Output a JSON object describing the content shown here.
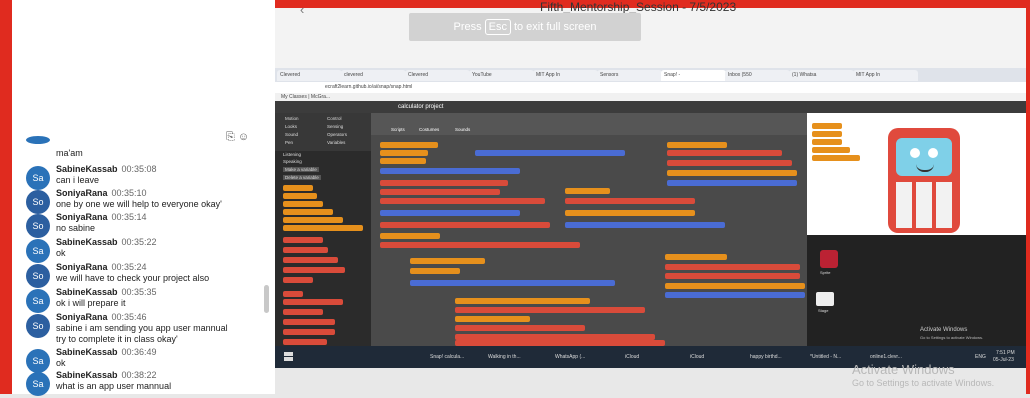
{
  "meeting": {
    "title": "Fifth_Mentorship_Session - 7/5/2023",
    "esc_prefix": "Press",
    "esc_key": "Esc",
    "esc_suffix": "to exit full screen"
  },
  "chat": {
    "messages": [
      {
        "initials": "",
        "name": "",
        "time": "",
        "text": "ma'am",
        "text2": ""
      },
      {
        "initials": "Sa",
        "name": "SabineKassab",
        "time": "00:35:08",
        "text": "can i leave",
        "text2": ""
      },
      {
        "initials": "So",
        "name": "SoniyaRana",
        "time": "00:35:10",
        "text": "one by one we will help to everyone okay'",
        "text2": ""
      },
      {
        "initials": "So",
        "name": "SoniyaRana",
        "time": "00:35:14",
        "text": "no sabine",
        "text2": ""
      },
      {
        "initials": "Sa",
        "name": "SabineKassab",
        "time": "00:35:22",
        "text": "ok",
        "text2": ""
      },
      {
        "initials": "So",
        "name": "SoniyaRana",
        "time": "00:35:24",
        "text": "we will have to check your project also",
        "text2": ""
      },
      {
        "initials": "Sa",
        "name": "SabineKassab",
        "time": "00:35:35",
        "text": "ok i will prepare it",
        "text2": ""
      },
      {
        "initials": "So",
        "name": "SoniyaRana",
        "time": "00:35:46",
        "text": "sabine i am sending you app user mannual",
        "text2": "try to complete it in class okay'"
      },
      {
        "initials": "Sa",
        "name": "SabineKassab",
        "time": "00:36:49",
        "text": "ok",
        "text2": ""
      },
      {
        "initials": "Sa",
        "name": "SabineKassab",
        "time": "00:38:22",
        "text": "what is an app user mannual",
        "text2": ""
      }
    ]
  },
  "browser": {
    "tabs": [
      "Clevered",
      "clevered",
      "Clevered",
      "YouTube",
      "MIT App In",
      "Sensors",
      "Snap! -",
      "Inbox (550",
      "(1) Whatsa",
      "MIT App In"
    ],
    "address": "ecraft2learn.github.io/ai/snap/snap.html",
    "bookmark": "My Classes | McGra..."
  },
  "snap": {
    "project_title": "calculator project",
    "categories": [
      "Motion",
      "Looks",
      "Sound",
      "Pen",
      "Control",
      "Sensing",
      "Operators",
      "Variables"
    ],
    "palette_extra": [
      "Listening",
      "Speaking"
    ],
    "make_variable": "Make a variable",
    "delete_variable": "Delete a variable",
    "tabs": [
      "Scripts",
      "Costumes",
      "Sounds"
    ],
    "sprite_label": "Sprite",
    "stage_label": "Stage"
  },
  "taskbar": {
    "items": [
      "Snap! calcula...",
      "Walking in th...",
      "WhatsApp (...",
      "iCloud",
      "iCloud",
      "happy birthd...",
      "*Untitled - N...",
      "online1.clevr..."
    ],
    "lang": "ENG",
    "time": "7:51 PM",
    "date": "05-Jul-23"
  },
  "activation": {
    "title": "Activate Windows",
    "subtitle": "Go to Settings to activate Windows.",
    "small_title": "Activate Windows",
    "small_subtitle": "Go to Settings to activate Windows."
  },
  "colors": {
    "accent_red": "#e02b1f",
    "avatar_blue": "#2a72b8",
    "snap_orange": "#e6901c",
    "snap_red": "#d94b3a",
    "snap_blue": "#4a6cd4"
  }
}
